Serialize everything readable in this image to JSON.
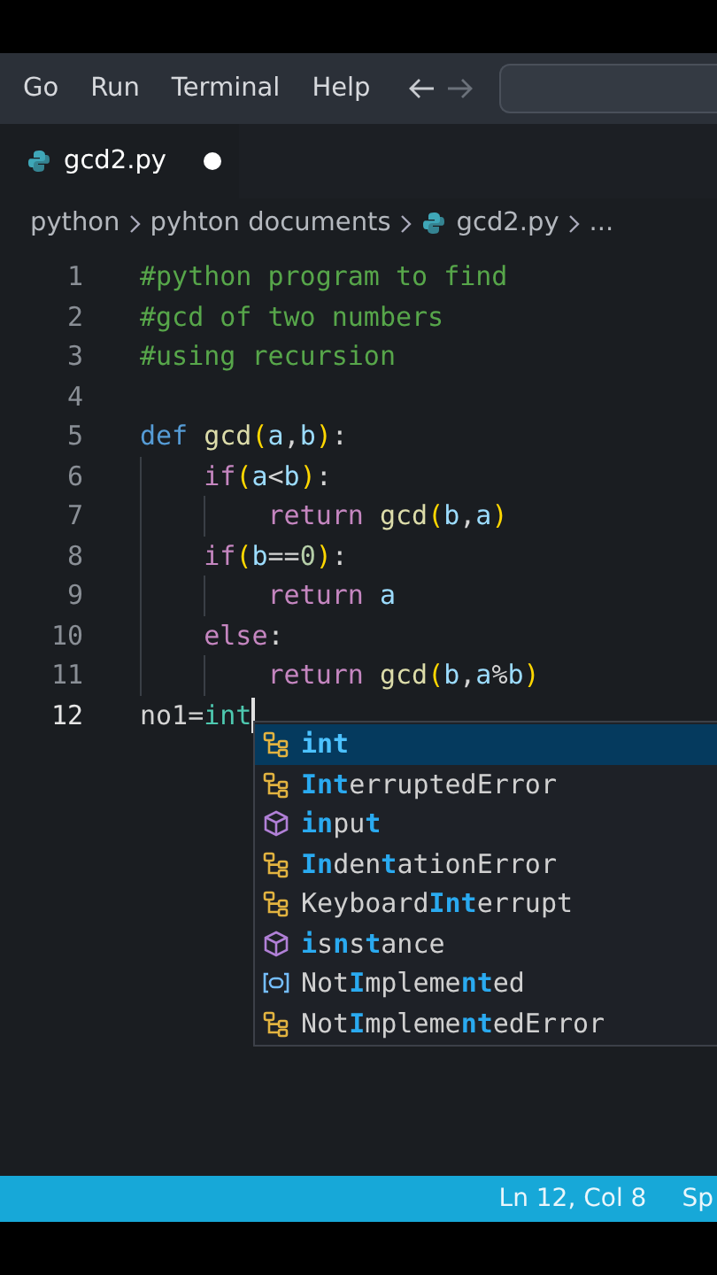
{
  "menu_bar": {
    "items": [
      "Go",
      "Run",
      "Terminal",
      "Help"
    ],
    "back_disabled": false,
    "forward_disabled": true
  },
  "tabs": [
    {
      "label": "gcd2.py",
      "selected": true,
      "modified": true
    }
  ],
  "breadcrumb": [
    {
      "text": "python",
      "kind": "folder"
    },
    {
      "text": "pyhton documents",
      "kind": "folder"
    },
    {
      "text": "gcd2.py",
      "kind": "file"
    },
    {
      "text": "...",
      "kind": "more"
    }
  ],
  "editor": {
    "lines": [
      {
        "number": "1",
        "tokens": [
          {
            "text": "#python program to find",
            "kind": "comment"
          }
        ]
      },
      {
        "number": "2",
        "tokens": [
          {
            "text": "#gcd of two numbers",
            "kind": "comment"
          }
        ]
      },
      {
        "number": "3",
        "tokens": [
          {
            "text": "#using recursion",
            "kind": "comment"
          }
        ]
      },
      {
        "number": "4"
      },
      {
        "number": "5",
        "tokens": [
          {
            "text": "def",
            "kind": "keyword"
          },
          {
            "text": " gcd",
            "kind": "function"
          },
          {
            "text": "(",
            "kind": "paren"
          },
          {
            "text": "a",
            "kind": "variable"
          },
          {
            "text": ",",
            "kind": "plain"
          },
          {
            "text": "b",
            "kind": "variable"
          },
          {
            "text": ")",
            "kind": "paren"
          },
          {
            "text": ":",
            "kind": "plain"
          }
        ]
      },
      {
        "number": "6",
        "tokens": [
          {
            "text": "    if",
            "kind": "control"
          },
          {
            "text": "(",
            "kind": "paren"
          },
          {
            "text": "a",
            "kind": "variable"
          },
          {
            "text": "<",
            "kind": "plain"
          },
          {
            "text": "b",
            "kind": "variable"
          },
          {
            "text": ")",
            "kind": "paren"
          },
          {
            "text": ":",
            "kind": "plain"
          }
        ]
      },
      {
        "number": "7",
        "tokens": [
          {
            "text": "        return",
            "kind": "control"
          },
          {
            "text": " gcd",
            "kind": "function"
          },
          {
            "text": "(",
            "kind": "paren"
          },
          {
            "text": "b",
            "kind": "variable"
          },
          {
            "text": ",",
            "kind": "plain"
          },
          {
            "text": "a",
            "kind": "variable"
          },
          {
            "text": ")",
            "kind": "paren"
          }
        ]
      },
      {
        "number": "8",
        "tokens": [
          {
            "text": "    if",
            "kind": "control"
          },
          {
            "text": "(",
            "kind": "paren"
          },
          {
            "text": "b",
            "kind": "variable"
          },
          {
            "text": "==",
            "kind": "plain"
          },
          {
            "text": "0",
            "kind": "number"
          },
          {
            "text": ")",
            "kind": "paren"
          },
          {
            "text": ":",
            "kind": "plain"
          }
        ]
      },
      {
        "number": "9",
        "tokens": [
          {
            "text": "        return",
            "kind": "control"
          },
          {
            "text": " a",
            "kind": "variable"
          }
        ]
      },
      {
        "number": "10",
        "tokens": [
          {
            "text": "    else",
            "kind": "control"
          },
          {
            "text": ":",
            "kind": "plain"
          }
        ]
      },
      {
        "number": "11",
        "tokens": [
          {
            "text": "        return",
            "kind": "control"
          },
          {
            "text": " gcd",
            "kind": "function"
          },
          {
            "text": "(",
            "kind": "paren"
          },
          {
            "text": "b",
            "kind": "variable"
          },
          {
            "text": ",",
            "kind": "plain"
          },
          {
            "text": "a",
            "kind": "variable"
          },
          {
            "text": "%",
            "kind": "plain"
          },
          {
            "text": "b",
            "kind": "variable"
          },
          {
            "text": ")",
            "kind": "paren"
          }
        ]
      },
      {
        "number": "12",
        "cursor": true,
        "tokens": [
          {
            "text": "no1",
            "kind": "plain"
          },
          {
            "text": "=",
            "kind": "plain"
          },
          {
            "text": "int",
            "kind": "class"
          }
        ]
      }
    ]
  },
  "suggestions": [
    {
      "label": "**int**",
      "kind": "class",
      "selected": true
    },
    {
      "label": "**Int**erruptedError",
      "kind": "class",
      "selected": false
    },
    {
      "label": "**in**pu**t**",
      "kind": "function",
      "selected": false
    },
    {
      "label": "**In**den**t**ationError",
      "kind": "class",
      "selected": false
    },
    {
      "label": "Keyboard**Int**errupt",
      "kind": "class",
      "selected": false
    },
    {
      "label": "**i**s**n**s**t**ance",
      "kind": "function",
      "selected": false
    },
    {
      "label": "Not**I**mpleme**nt**ed",
      "kind": "variable",
      "selected": false
    },
    {
      "label": "Not**I**mpleme**nt**edError",
      "kind": "class",
      "selected": false
    }
  ],
  "status_bar": {
    "items": [
      "Ln 12, Col 8",
      "Sp"
    ]
  }
}
